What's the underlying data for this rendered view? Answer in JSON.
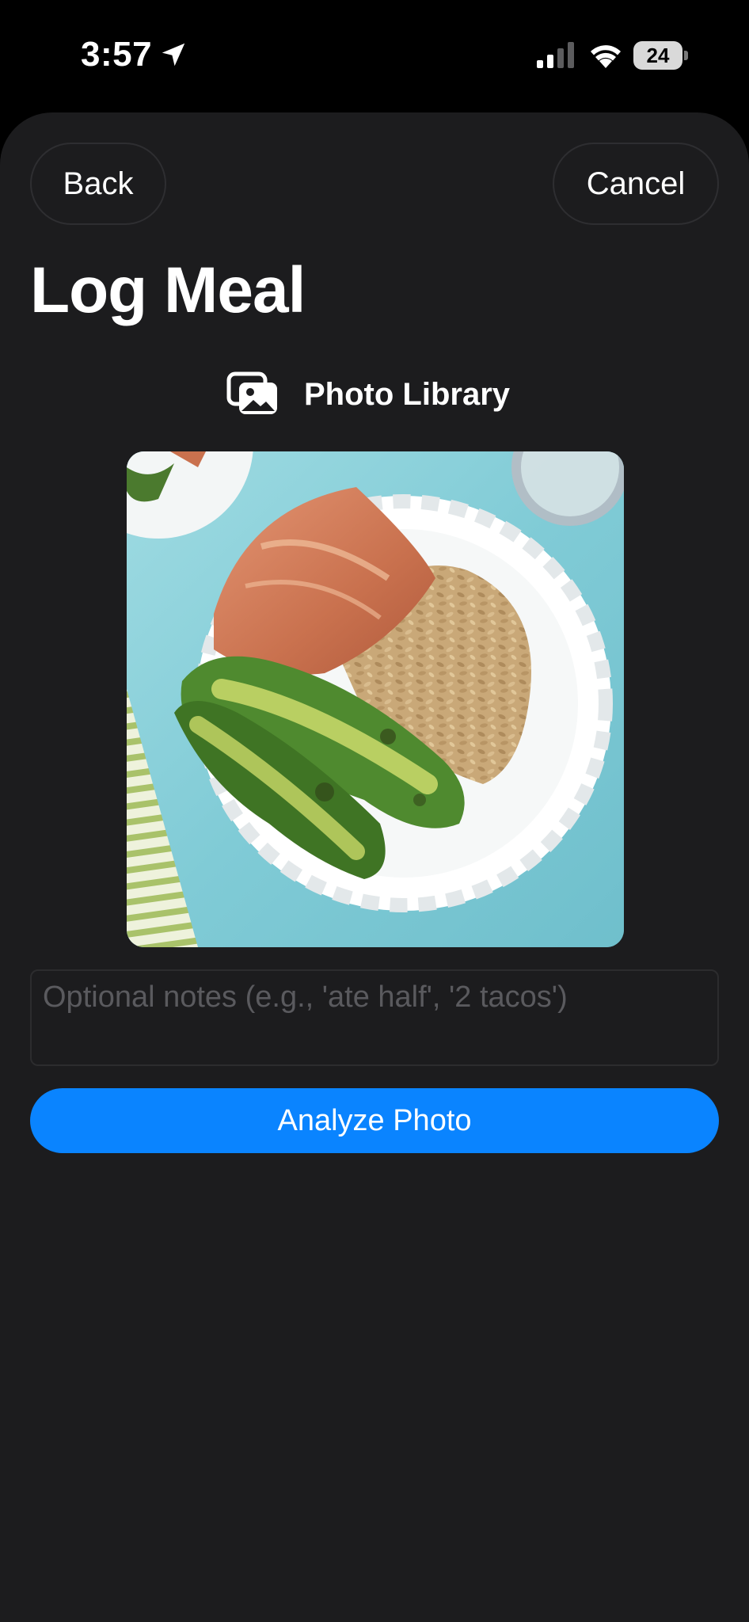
{
  "status_bar": {
    "time": "3:57",
    "battery_level": "24",
    "icons": [
      "location-arrow-icon",
      "cellular-signal-icon",
      "wifi-icon",
      "battery-icon"
    ]
  },
  "nav": {
    "back_label": "Back",
    "cancel_label": "Cancel"
  },
  "page": {
    "title": "Log Meal"
  },
  "source": {
    "label": "Photo Library",
    "icon": "photo-library-icon"
  },
  "notes": {
    "value": "",
    "placeholder": "Optional notes (e.g., 'ate half', '2 tacos')"
  },
  "actions": {
    "analyze_label": "Analyze Photo"
  },
  "colors": {
    "background": "#000000",
    "sheet": "#1c1c1e",
    "accent": "#0a84ff",
    "placeholder": "#5a5a5e"
  }
}
